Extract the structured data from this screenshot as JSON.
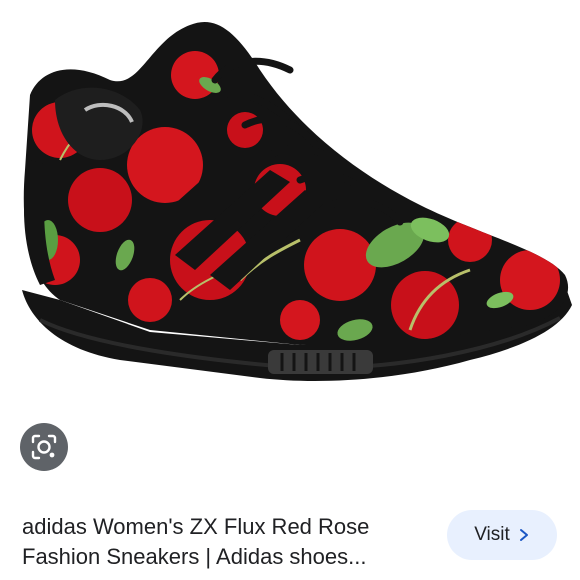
{
  "product": {
    "title_line1": "adidas Women's ZX Flux Red Rose",
    "title_line2": "Fashion Sneakers | Adidas shoes...",
    "image_icon": "sneaker-image"
  },
  "actions": {
    "visit_label": "Visit",
    "visit_icon": "chevron-right-icon",
    "lens_icon": "lens-search-icon"
  },
  "colors": {
    "shoe_black": "#141414",
    "rose_red": "#d0141c",
    "leaf_green": "#6aa84f",
    "visit_bg": "#e8f0fe",
    "lens_bg": "#5f6368",
    "text": "#202124"
  }
}
